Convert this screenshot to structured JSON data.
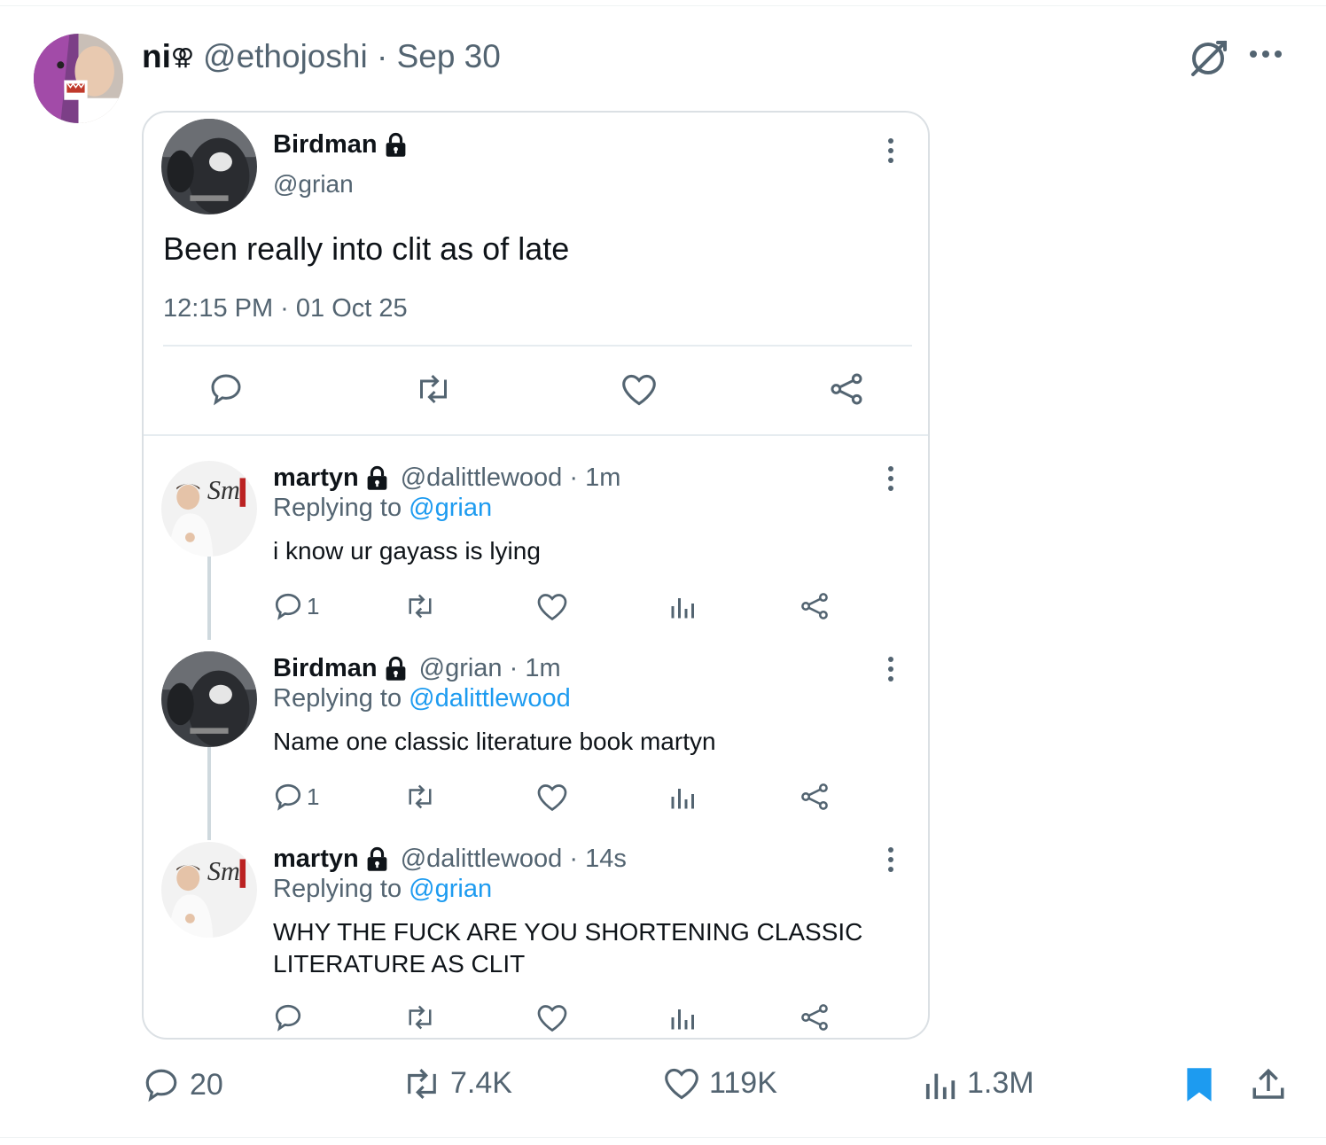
{
  "outer_tweet": {
    "name": "ni",
    "name_glyph": "⚢",
    "handle_date": "@ethojoshi · Sep 30",
    "actions": {
      "replies": "20",
      "reposts": "7.4K",
      "likes": "119K",
      "views": "1.3M"
    },
    "icons": [
      "grok-icon",
      "more-icon",
      "reply-icon",
      "repost-icon",
      "like-icon",
      "views-icon",
      "bookmark-icon",
      "share-icon"
    ],
    "bookmark_color": "#1d9bf0"
  },
  "screenshot": {
    "main_post": {
      "name": "Birdman",
      "handle": "@grian",
      "text": "Been really into clit as of late",
      "timestamp": "12:15 PM · 01 Oct 25"
    },
    "replies": [
      {
        "name": "martyn",
        "meta": "@dalittlewood · 1m",
        "replying_prefix": "Replying to ",
        "replying_to": "@grian",
        "text": "i know ur gayass is lying",
        "reply_count": "1"
      },
      {
        "name": "Birdman",
        "meta": "@grian · 1m",
        "replying_prefix": "Replying to ",
        "replying_to": "@dalittlewood",
        "text": "Name one classic literature book martyn",
        "reply_count": "1"
      },
      {
        "name": "martyn",
        "meta": "@dalittlewood · 14s",
        "replying_prefix": "Replying to ",
        "replying_to": "@grian",
        "text_line1": "WHY THE FUCK ARE YOU SHORTENING CLASSIC",
        "text_line2": "LITERATURE AS CLIT",
        "reply_count": ""
      }
    ]
  },
  "colors": {
    "text": "#0f1419",
    "muted": "#536471",
    "link": "#1d9bf0",
    "border": "#dbe0e4"
  }
}
